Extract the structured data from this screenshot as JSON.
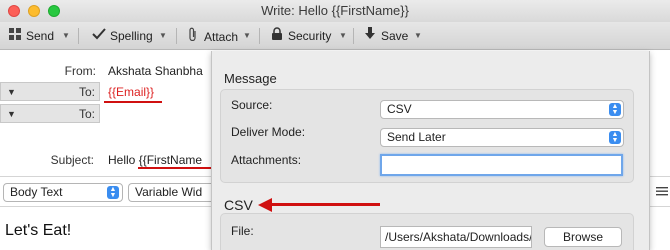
{
  "window": {
    "title": "Write: Hello {{FirstName}}"
  },
  "toolbar": {
    "send_label": "Send",
    "spelling_label": "Spelling",
    "attach_label": "Attach",
    "security_label": "Security",
    "save_label": "Save"
  },
  "header": {
    "from_label": "From:",
    "from_value": "Akshata Shanbha",
    "to_label": "To:",
    "to_value": "{{Email}}",
    "second_to_label": "To:",
    "subject_label": "Subject:",
    "subject_prefix": "Hello ",
    "subject_token": "{{FirstName"
  },
  "format_bar": {
    "paragraph_style": "Body Text",
    "font": "Variable Wid"
  },
  "body": {
    "text": "Let's Eat!"
  },
  "panel": {
    "message_title": "Message",
    "source_label": "Source:",
    "source_value": "CSV",
    "deliver_label": "Deliver Mode:",
    "deliver_value": "Send Later",
    "attachments_label": "Attachments:",
    "attachments_value": "",
    "csv_title": "CSV",
    "file_label": "File:",
    "file_value": "/Users/Akshata/Downloads/",
    "browse_label": "Browse"
  },
  "colors": {
    "annotation_red": "#d01010",
    "token_red": "#dd2222",
    "accent_blue": "#3a8df0"
  },
  "icons": [
    "send-icon",
    "spelling-check-icon",
    "paperclip-icon",
    "lock-icon",
    "save-arrow-icon"
  ]
}
